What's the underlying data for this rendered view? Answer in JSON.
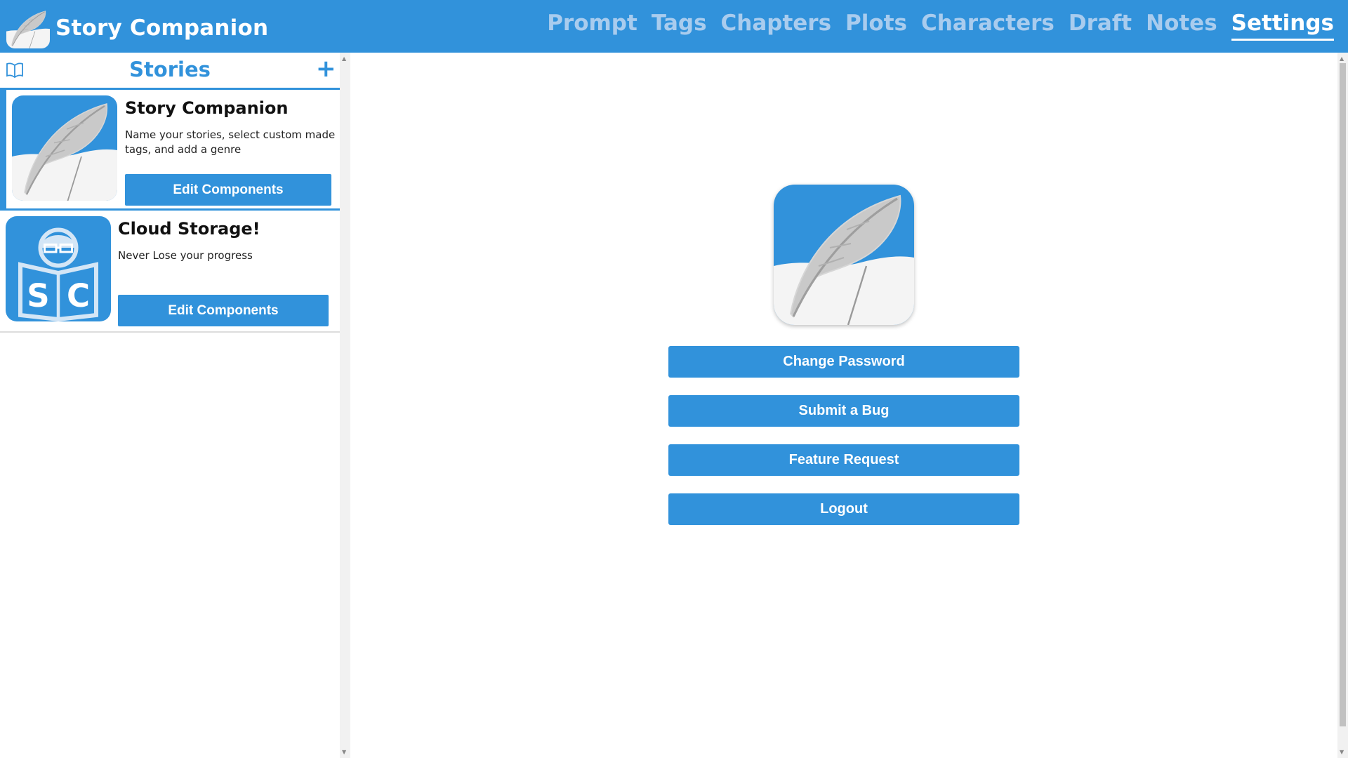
{
  "app": {
    "title": "Story Companion"
  },
  "nav": {
    "items": [
      {
        "label": "Prompt",
        "active": false
      },
      {
        "label": "Tags",
        "active": false
      },
      {
        "label": "Chapters",
        "active": false
      },
      {
        "label": "Plots",
        "active": false
      },
      {
        "label": "Characters",
        "active": false
      },
      {
        "label": "Draft",
        "active": false
      },
      {
        "label": "Notes",
        "active": false
      },
      {
        "label": "Settings",
        "active": true
      }
    ]
  },
  "sidebar": {
    "title": "Stories",
    "add_icon": "plus-icon",
    "book_icon": "open-book-icon",
    "stories": [
      {
        "title": "Story Companion",
        "description": "Name your stories, select custom made tags, and add a genre",
        "button": "Edit Components",
        "thumbnail": "quill-logo",
        "selected": true
      },
      {
        "title": "Cloud Storage!",
        "description": "Never Lose your progress",
        "button": "Edit Components",
        "thumbnail": "reader-sc-logo",
        "selected": false
      }
    ]
  },
  "settings": {
    "buttons": [
      "Change Password",
      "Submit a Bug",
      "Feature Request",
      "Logout"
    ]
  },
  "colors": {
    "brand_blue": "#3192db",
    "nav_inactive": "#a9ccee",
    "white": "#ffffff"
  }
}
